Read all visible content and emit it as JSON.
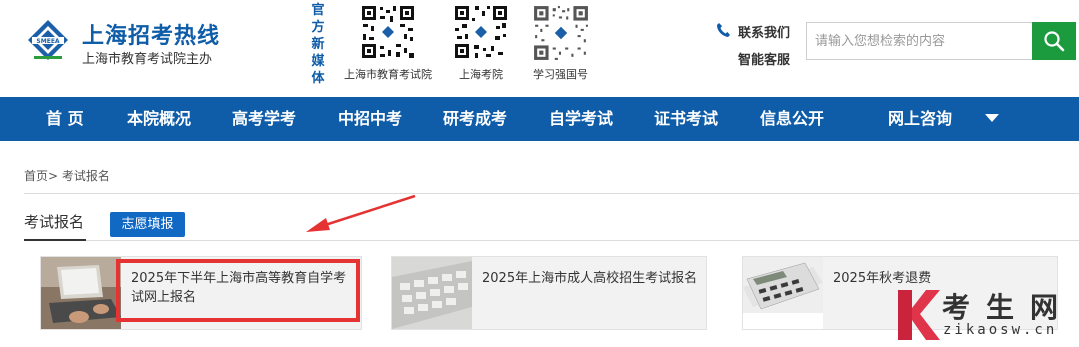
{
  "header": {
    "logo_badge": "SMEEA",
    "site_title": "上海招考热线",
    "site_subtitle": "上海市教育考试院主办",
    "media_label": [
      "官",
      "方",
      "新",
      "媒",
      "体"
    ],
    "qr_codes": [
      {
        "caption": "上海市教育考试院"
      },
      {
        "caption": "上海考院"
      },
      {
        "caption": "学习强国号"
      }
    ],
    "contact_line1": "联系我们",
    "contact_line2": "智能客服",
    "search": {
      "placeholder": "请输入您想检索的内容",
      "value": ""
    }
  },
  "nav": {
    "items": [
      "首 页",
      "本院概况",
      "高考学考",
      "中招中考",
      "研考成考",
      "自学考试",
      "证书考试",
      "信息公开",
      "网上咨询"
    ]
  },
  "breadcrumb": "首页> 考试报名",
  "tabs": {
    "active": "考试报名",
    "button": "志愿填报"
  },
  "cards": [
    {
      "title": "2025年下半年上海市高等教育自学考试网上报名"
    },
    {
      "title": "2025年上海市成人高校招生考试报名"
    },
    {
      "title": "2025年秋考退费"
    }
  ],
  "watermark": {
    "line1": "考生网",
    "line2": "zikaosw.cn"
  },
  "colors": {
    "brand_blue": "#0f5ca8",
    "search_green": "#1b9b3e",
    "highlight_red": "#e53333",
    "tab_blue": "#1269c4"
  }
}
